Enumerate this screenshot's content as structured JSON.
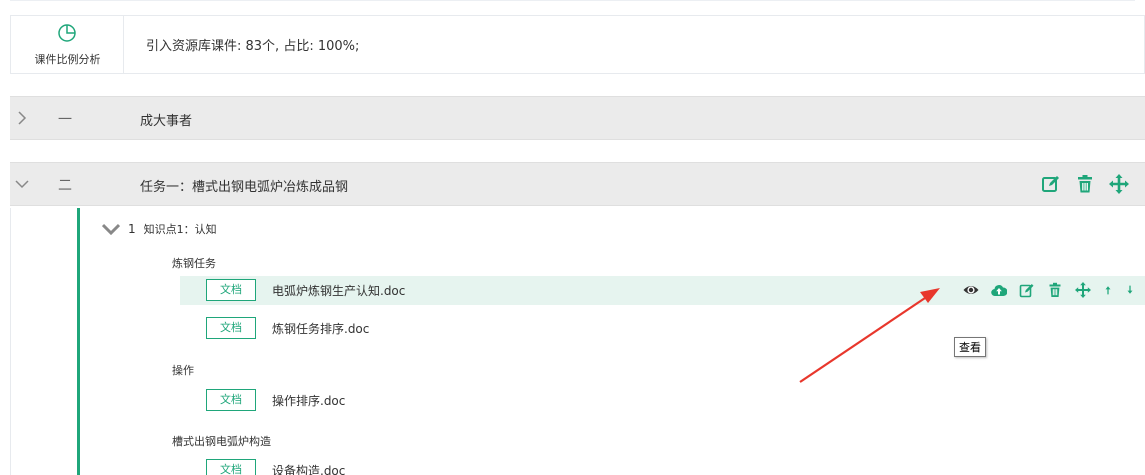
{
  "stats": {
    "tile_label": "课件比例分析",
    "tile_icon": "pie-chart-icon",
    "summary": "引入资源库课件: 83个, 占比: 100%;"
  },
  "chapters": [
    {
      "num": "一",
      "title": "成大事者",
      "expanded": false
    },
    {
      "num": "二",
      "title": "任务一：槽式出钢电弧炉冶炼成品钢",
      "expanded": true
    }
  ],
  "knowledge_point": {
    "num": "1",
    "label": "知识点1：认知"
  },
  "groups": [
    {
      "title": "炼钢任务",
      "files": [
        {
          "tag": "文档",
          "name": "电弧炉炼钢生产认知.doc",
          "highlighted": true
        },
        {
          "tag": "文档",
          "name": "炼钢任务排序.doc",
          "highlighted": false
        }
      ]
    },
    {
      "title": "操作",
      "files": [
        {
          "tag": "文档",
          "name": "操作排序.doc",
          "highlighted": false
        }
      ]
    },
    {
      "title": "槽式出钢电弧炉构造",
      "files": [
        {
          "tag": "文档",
          "name": "设备构造.doc",
          "highlighted": false
        }
      ]
    }
  ],
  "tooltip": "查看",
  "colors": {
    "accent": "#1fa67a",
    "header_bg": "#ebebeb",
    "highlight_row": "#e6f4ef",
    "pointer_arrow": "#e8372c"
  },
  "icons": {
    "row_actions": [
      "eye-icon",
      "cloud-upload-icon",
      "edit-icon",
      "trash-icon",
      "move-icon",
      "arrow-up-icon",
      "arrow-down-icon"
    ],
    "chapter_actions": [
      "edit-icon",
      "trash-icon",
      "move-icon"
    ]
  }
}
